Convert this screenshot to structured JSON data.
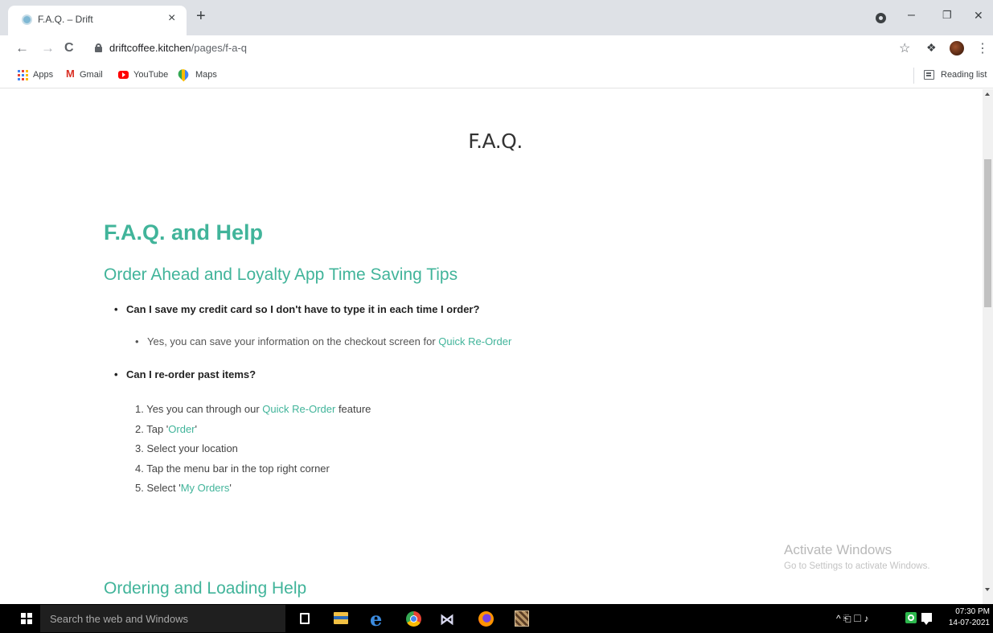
{
  "browser": {
    "tab": {
      "title": "F.A.Q. – Drift",
      "close": "×"
    },
    "new_tab": "+",
    "window_controls": {
      "minimize": "–",
      "maximize": "❐",
      "close": "✕"
    },
    "nav": {
      "back": "←",
      "forward": "→",
      "reload": "C"
    },
    "url": {
      "domain": "driftcoffee.kitchen",
      "path": "/pages/f-a-q"
    },
    "menu": "⋮",
    "star": "☆",
    "extension": "❖",
    "bookmarks": [
      {
        "label": "Apps",
        "icon": "apps-grid-icon"
      },
      {
        "label": "Gmail",
        "icon": "gmail-icon"
      },
      {
        "label": "YouTube",
        "icon": "youtube-icon"
      },
      {
        "label": "Maps",
        "icon": "maps-icon"
      }
    ],
    "gmail_glyph": "M",
    "reading_list": "Reading list"
  },
  "page": {
    "title": "F.A.Q.",
    "heading": "F.A.Q. and Help",
    "section1": {
      "heading": "Order Ahead and Loyalty App Time Saving Tips",
      "q1": "Can I save my credit card so I don't have to type it in each time I order?",
      "a1_text": "Yes, you can save your information on the checkout screen for ",
      "a1_link": "Quick Re-Order",
      "q2": "Can I re-order past items?",
      "steps": {
        "s1_pre": "1. Yes you can through our ",
        "s1_link": "Quick Re-Order",
        "s1_post": " feature",
        "s2_pre": "2. Tap '",
        "s2_link": "Order",
        "s2_post": "'",
        "s3": "3. Select your location",
        "s4": "4. Tap the menu bar in the top right corner",
        "s5_pre": "5. Select '",
        "s5_link": "My Orders",
        "s5_post": "'"
      }
    },
    "section2": {
      "heading": "Ordering and Loading Help"
    }
  },
  "watermark": {
    "title": "Activate Windows",
    "subtitle": "Go to Settings to activate Windows."
  },
  "taskbar": {
    "search_placeholder": "Search the web and Windows",
    "edge_glyph": "e",
    "mail_glyph": "⋈",
    "tray_icons": "^ ⎗ ☐ ♪",
    "time": "07:30 PM",
    "date": "14-07-2021"
  },
  "colors": {
    "accent": "#41b49a",
    "taskbar": "#000000",
    "tabbar": "#dee1e6"
  }
}
